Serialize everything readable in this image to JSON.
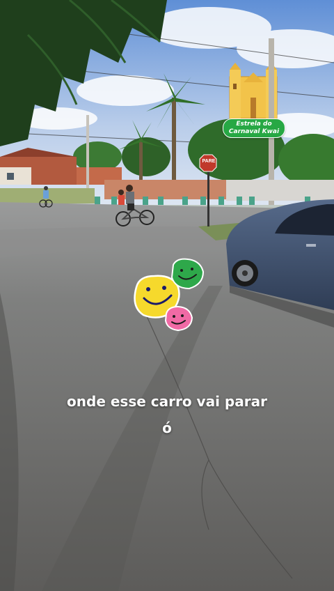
{
  "caption": {
    "line1": "onde esse carro vai parar",
    "line2": "ó"
  },
  "badge": {
    "line1": "Estrela do",
    "line2": "Carnaval Kwai",
    "color": "#27a844"
  },
  "stop_sign": {
    "text": "PARE",
    "color": "#c0392b"
  },
  "stickers": {
    "yellow_face_color": "#f6d92c",
    "green_face_color": "#2ea84a",
    "pink_face_color": "#f06aa5"
  }
}
